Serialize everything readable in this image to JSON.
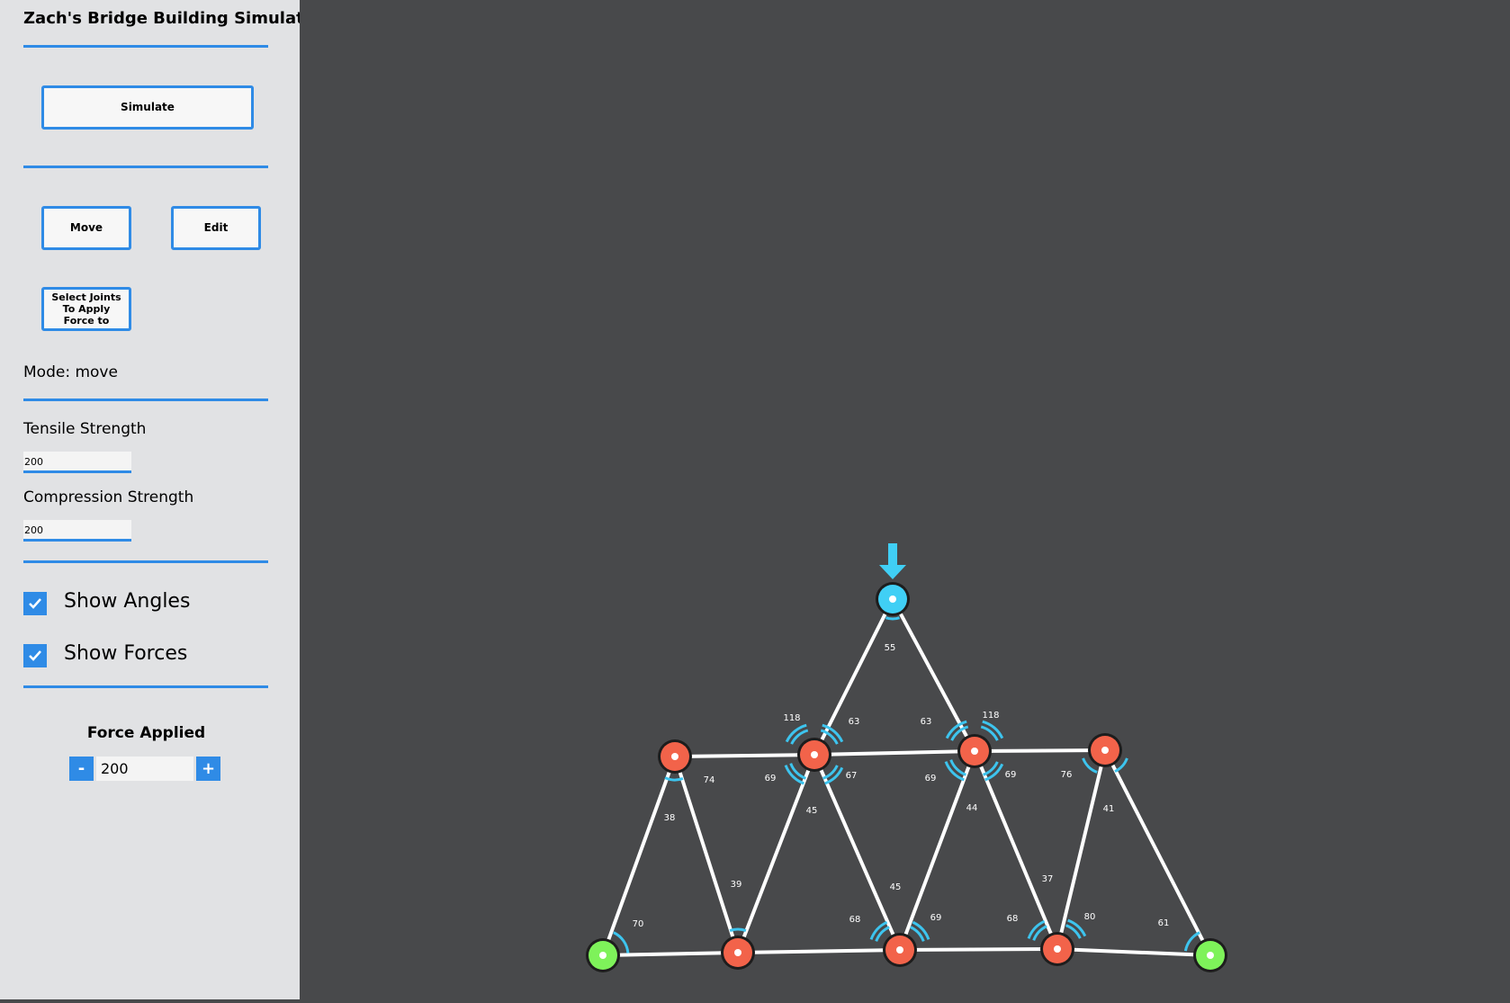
{
  "app": {
    "title": "Zach's Bridge Building Simulator"
  },
  "buttons": {
    "simulate": "Simulate",
    "move": "Move",
    "edit": "Edit",
    "select_joints": [
      "Select Joints",
      "To Apply",
      "Force to"
    ]
  },
  "mode": {
    "text": "Mode: move"
  },
  "materials": {
    "tensile_label": "Tensile Strength",
    "tensile_value": "200",
    "compression_label": "Compression Strength",
    "compression_value": "200"
  },
  "toggles": {
    "show_angles": {
      "label": "Show Angles",
      "checked": true
    },
    "show_forces": {
      "label": "Show Forces",
      "checked": true
    }
  },
  "force": {
    "title": "Force Applied",
    "value": "200",
    "minus": "-",
    "plus": "+"
  },
  "colors": {
    "accent": "#2f8be6",
    "joint_fixed": "#7ef25a",
    "joint_free": "#f2634a",
    "joint_loaded": "#40cff5",
    "member": "#ffffff",
    "angle_arc": "#3dc4ee",
    "canvas_bg": "#48494b"
  },
  "bridge": {
    "joints": [
      {
        "id": "A",
        "type": "fixed"
      },
      {
        "id": "B",
        "type": "free"
      },
      {
        "id": "C",
        "type": "free"
      },
      {
        "id": "D",
        "type": "free"
      },
      {
        "id": "E",
        "type": "fixed"
      },
      {
        "id": "F",
        "type": "free"
      },
      {
        "id": "G",
        "type": "free"
      },
      {
        "id": "H",
        "type": "free"
      },
      {
        "id": "I",
        "type": "free"
      },
      {
        "id": "J",
        "type": "loaded"
      }
    ],
    "members": [
      [
        "A",
        "B"
      ],
      [
        "B",
        "C"
      ],
      [
        "C",
        "D"
      ],
      [
        "D",
        "E"
      ],
      [
        "F",
        "G"
      ],
      [
        "G",
        "H"
      ],
      [
        "H",
        "I"
      ],
      [
        "A",
        "F"
      ],
      [
        "F",
        "B"
      ],
      [
        "B",
        "G"
      ],
      [
        "G",
        "C"
      ],
      [
        "C",
        "H"
      ],
      [
        "H",
        "D"
      ],
      [
        "D",
        "I"
      ],
      [
        "I",
        "E"
      ],
      [
        "G",
        "J"
      ],
      [
        "J",
        "H"
      ]
    ],
    "angle_labels": [
      "55",
      "118",
      "63",
      "63",
      "118",
      "74",
      "69",
      "67",
      "69",
      "69",
      "76",
      "38",
      "45",
      "44",
      "41",
      "39",
      "45",
      "37",
      "70",
      "68",
      "69",
      "68",
      "80",
      "61"
    ]
  }
}
